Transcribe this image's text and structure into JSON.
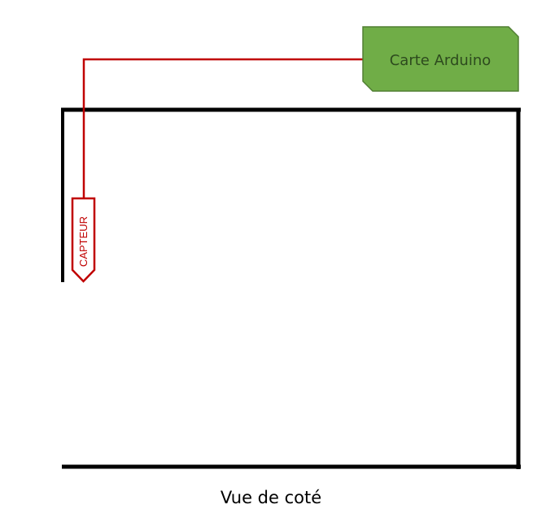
{
  "arduino_board": {
    "label": "Carte Arduino",
    "fill_color": "#70AD47",
    "border_color": "#507E32",
    "text_color": "#2D4A1E"
  },
  "sensor": {
    "label": "CAPTEUR",
    "color": "#C00000"
  },
  "wire": {
    "color": "#C00000"
  },
  "container": {
    "stroke_color": "#000000"
  },
  "caption": {
    "text": "Vue de coté"
  }
}
